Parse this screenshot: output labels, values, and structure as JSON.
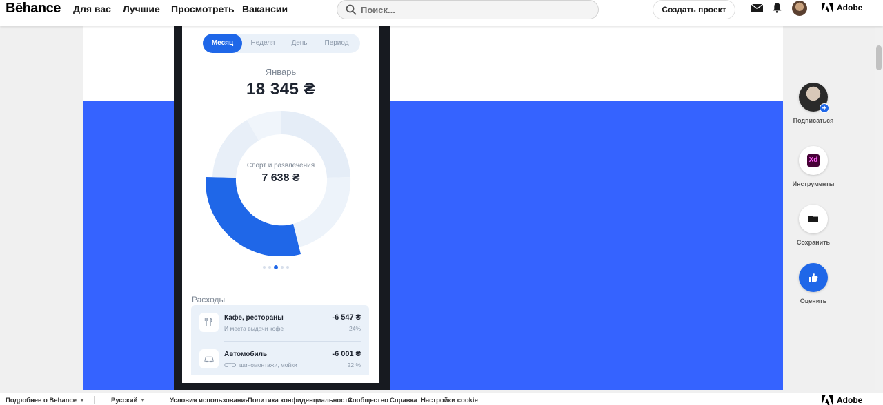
{
  "header": {
    "logo": "Bēhance",
    "nav": [
      "Для вас",
      "Лучшие",
      "Просмотреть",
      "Вакансии"
    ],
    "search_placeholder": "Поиск...",
    "create_button": "Создать проект",
    "adobe_label": "Adobe",
    "icons": [
      "mail-icon",
      "bell-icon",
      "user-avatar",
      "adobe-logo-icon"
    ]
  },
  "phone": {
    "tabs": [
      "Месяц",
      "Неделя",
      "День",
      "Период"
    ],
    "active_tab": "Месяц",
    "month": "Январь",
    "total": "18 345 ₴",
    "donut": {
      "category": "Спорт и развлечения",
      "value": "7 638 ₴",
      "colors": [
        "#1f67e8",
        "#e6eef8",
        "#dce7f3",
        "#edf3fa"
      ]
    },
    "pager": {
      "pages": 5,
      "active": 3
    },
    "expenses_title": "Расходы",
    "expenses": [
      {
        "name": "Кафе, рестораны",
        "subtitle": "И места выдачи кофе",
        "amount": "-6 547 ₴",
        "percent": "24%",
        "icon": "cutlery-icon"
      },
      {
        "name": "Автомобиль",
        "subtitle": "СТО, шиномонтажи, мойки",
        "amount": "-6 001 ₴",
        "percent": "22 %",
        "icon": "car-icon"
      }
    ]
  },
  "rail": {
    "follow": "Подписаться",
    "tools": "Инструменты",
    "tools_badge": "Xd",
    "save": "Сохранить",
    "appreciate": "Оценить"
  },
  "footer": {
    "more": "Подробнее о Behance",
    "language": "Русский",
    "links": [
      "Условия использования",
      "Политика конфиденциальности",
      "Сообщество",
      "Справка",
      "Настройки cookie"
    ],
    "adobe_label": "Adobe"
  },
  "colors": {
    "accent": "#1f67e8",
    "canvas_blue": "#3563ff"
  }
}
